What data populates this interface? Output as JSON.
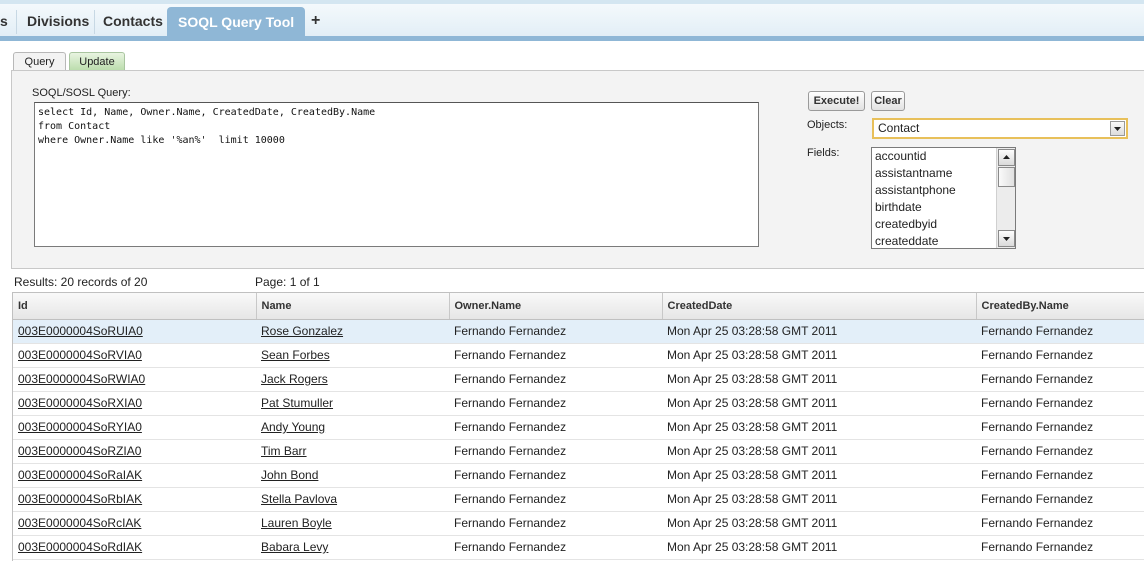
{
  "tabs": [
    {
      "label": "s"
    },
    {
      "label": "Divisions"
    },
    {
      "label": "Contacts"
    },
    {
      "label": "SOQL Query Tool"
    }
  ],
  "add_tab_icon": "+",
  "subtabs": {
    "query": "Query",
    "update": "Update"
  },
  "query": {
    "label": "SOQL/SOSL Query:",
    "text": "select Id, Name, Owner.Name, CreatedDate, CreatedBy.Name\nfrom Contact\nwhere Owner.Name like '%an%'  limit 10000"
  },
  "buttons": {
    "execute": "Execute!",
    "clear": "Clear"
  },
  "objects": {
    "label": "Objects:",
    "selected": "Contact"
  },
  "fields": {
    "label": "Fields:",
    "items": [
      "accountid",
      "assistantname",
      "assistantphone",
      "birthdate",
      "createdbyid",
      "createddate"
    ]
  },
  "results": {
    "summary": "Results: 20 records of 20",
    "page": "Page: 1 of 1"
  },
  "table": {
    "columns": [
      "Id",
      "Name",
      "Owner.Name",
      "CreatedDate",
      "CreatedBy.Name"
    ],
    "rows": [
      [
        "003E0000004SoRUIA0",
        "Rose Gonzalez",
        "Fernando Fernandez",
        "Mon Apr 25 03:28:58 GMT 2011",
        "Fernando Fernandez"
      ],
      [
        "003E0000004SoRVIA0",
        "Sean Forbes",
        "Fernando Fernandez",
        "Mon Apr 25 03:28:58 GMT 2011",
        "Fernando Fernandez"
      ],
      [
        "003E0000004SoRWIA0",
        "Jack Rogers",
        "Fernando Fernandez",
        "Mon Apr 25 03:28:58 GMT 2011",
        "Fernando Fernandez"
      ],
      [
        "003E0000004SoRXIA0",
        "Pat Stumuller",
        "Fernando Fernandez",
        "Mon Apr 25 03:28:58 GMT 2011",
        "Fernando Fernandez"
      ],
      [
        "003E0000004SoRYIA0",
        "Andy Young",
        "Fernando Fernandez",
        "Mon Apr 25 03:28:58 GMT 2011",
        "Fernando Fernandez"
      ],
      [
        "003E0000004SoRZIA0",
        "Tim Barr",
        "Fernando Fernandez",
        "Mon Apr 25 03:28:58 GMT 2011",
        "Fernando Fernandez"
      ],
      [
        "003E0000004SoRaIAK",
        "John Bond",
        "Fernando Fernandez",
        "Mon Apr 25 03:28:58 GMT 2011",
        "Fernando Fernandez"
      ],
      [
        "003E0000004SoRbIAK",
        "Stella Pavlova",
        "Fernando Fernandez",
        "Mon Apr 25 03:28:58 GMT 2011",
        "Fernando Fernandez"
      ],
      [
        "003E0000004SoRcIAK",
        "Lauren Boyle",
        "Fernando Fernandez",
        "Mon Apr 25 03:28:58 GMT 2011",
        "Fernando Fernandez"
      ],
      [
        "003E0000004SoRdIAK",
        "Babara Levy",
        "Fernando Fernandez",
        "Mon Apr 25 03:28:58 GMT 2011",
        "Fernando Fernandez"
      ]
    ]
  },
  "colors": {
    "accent": "#8fb7d6",
    "selected_row": "#e3eff9",
    "select_border": "#e8c05a"
  }
}
